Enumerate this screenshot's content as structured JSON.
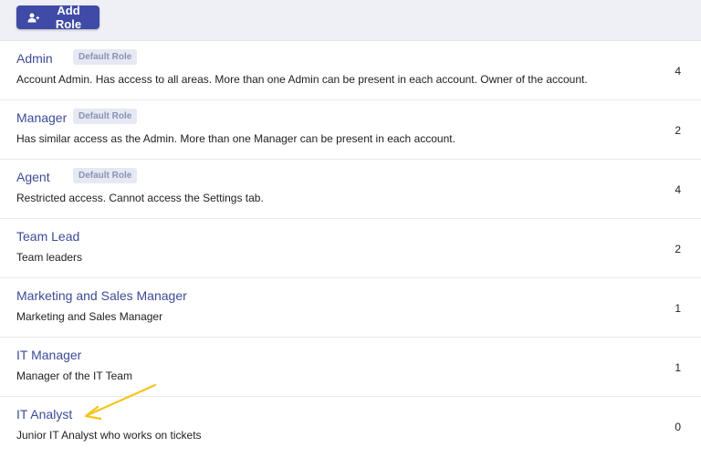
{
  "toolbar": {
    "add_role_label": "Add Role",
    "add_role_icon": "person-add-icon",
    "button_color": "#3f4ba6"
  },
  "roles": [
    {
      "name": "Admin",
      "badge": "Default Role",
      "description": "Account Admin. Has access to all areas. More than one Admin can be present in each account. Owner of the account.",
      "count": "4"
    },
    {
      "name": "Manager",
      "badge": "Default Role",
      "description": "Has similar access as the Admin. More than one Manager can be present in each account.",
      "count": "2"
    },
    {
      "name": "Agent",
      "badge": "Default Role",
      "description": "Restricted access. Cannot access the Settings tab.",
      "count": "4"
    },
    {
      "name": "Team Lead",
      "badge": "",
      "description": "Team leaders",
      "count": "2"
    },
    {
      "name": "Marketing and Sales Manager",
      "badge": "",
      "description": "Marketing and Sales Manager",
      "count": "1"
    },
    {
      "name": "IT Manager",
      "badge": "",
      "description": "Manager of the IT Team",
      "count": "1"
    },
    {
      "name": "IT Analyst",
      "badge": "",
      "description": "Junior IT Analyst who works on tickets",
      "count": "0"
    }
  ],
  "annotation": {
    "icon": "arrow-icon",
    "color": "#f5c518"
  }
}
